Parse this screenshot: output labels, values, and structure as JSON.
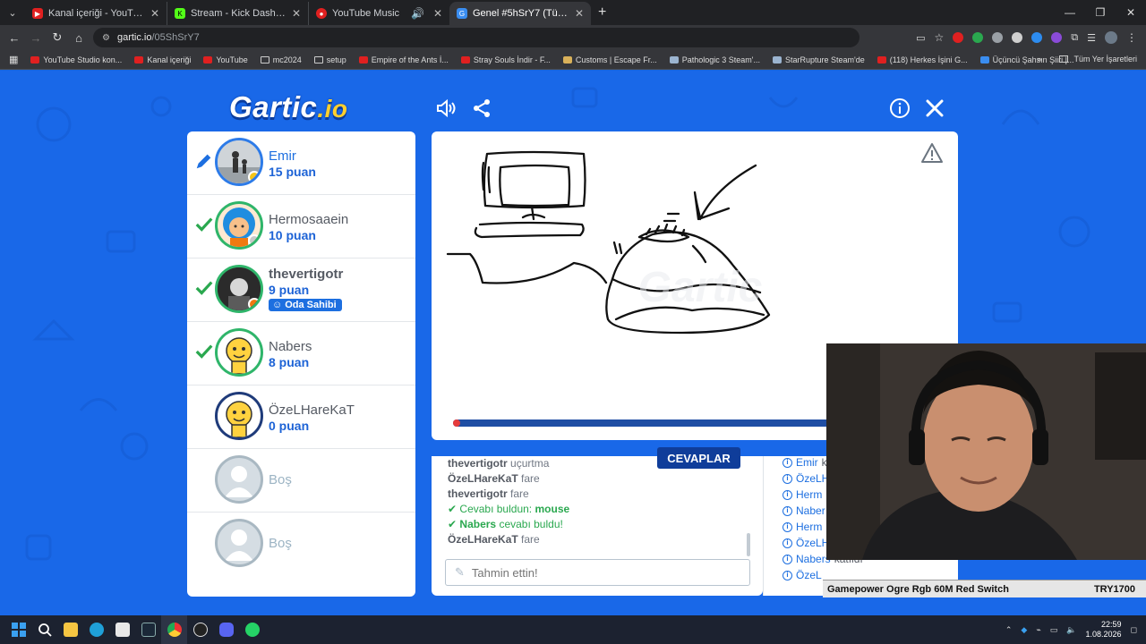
{
  "browser": {
    "tabs": [
      {
        "title": "Kanal içeriği - YouTube Studio",
        "color": "#e02020"
      },
      {
        "title": "Stream - Kick Dashboard",
        "color": "#53fc18"
      },
      {
        "title": "YouTube Music",
        "color": "#e02020"
      },
      {
        "title": "Genel #5hSrY7 (Türkçe) - Gartic",
        "color": "#3a8df0"
      }
    ],
    "url_host": "gartic.io",
    "url_path": "/05ShSrY7",
    "bookmarks": [
      "YouTube Studio kon...",
      "Kanal içeriği",
      "YouTube",
      "mc2024",
      "setup",
      "Empire of the Ants İ...",
      "Stray Souls İndir - F...",
      "Customs | Escape Fr...",
      "Pathologic 3 Steam'...",
      "StarRupture Steam'de",
      "(118) Herkes İşini G...",
      "Üçüncü Şahsın Şiiri |..."
    ],
    "bookmarks_all": "Tüm Yer İşaretleri"
  },
  "game": {
    "logo_main": "Gartic",
    "logo_suffix": ".io",
    "players": [
      {
        "name": "Emir",
        "score": "15 puan",
        "status_color": "#f5c518",
        "state": "drawing"
      },
      {
        "name": "Hermosaaein",
        "score": "10 puan",
        "status_color": "#c9c9c9",
        "state": "guessed"
      },
      {
        "name": "thevertigotr",
        "score": "9 puan",
        "status_color": "#f07a10",
        "state": "guessed",
        "badge": "Oda Sahibi"
      },
      {
        "name": "Nabers",
        "score": "8 puan",
        "status_color": "",
        "state": "guessed"
      },
      {
        "name": "ÖzeLHareKaT",
        "score": "0 puan",
        "status_color": "",
        "state": "none"
      }
    ],
    "empty_slots": [
      "Boş",
      "Boş"
    ],
    "answers_title": "CEVAPLAR",
    "answers": [
      {
        "name": "thevertigotr",
        "text": "uçurtma"
      },
      {
        "name": "ÖzeLHareKaT",
        "text": "fare"
      },
      {
        "name": "thevertigotr",
        "text": "fare"
      }
    ],
    "found_self_label": "Cevabı buldun:",
    "found_self_word": "mouse",
    "found_other_name": "Nabers",
    "found_other_text": "cevabı buldu!",
    "last_answer": {
      "name": "ÖzeLHareKaT",
      "text": "fare"
    },
    "guess_placeholder": "Tahmin ettin!",
    "timer_progress": 0.01,
    "chat": [
      {
        "name": "Emir",
        "text": "k"
      },
      {
        "name": "ÖzeLH",
        "text": ""
      },
      {
        "name": "Herm",
        "text": ""
      },
      {
        "name": "Naber",
        "text": ""
      },
      {
        "name": "Herm",
        "text": ""
      },
      {
        "name": "ÖzeLH",
        "text": ""
      },
      {
        "name": "Nabers",
        "text": "katıldı"
      },
      {
        "name": "ÖzeL",
        "text": ""
      }
    ]
  },
  "overlay": {
    "product": "Gamepower Ogre Rgb 60M Red Switch",
    "price": "TRY1700"
  },
  "taskbar": {
    "time": "22:59",
    "date": "1.08.2026"
  }
}
